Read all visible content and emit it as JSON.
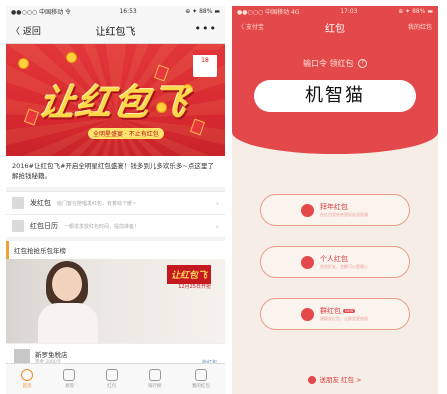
{
  "left": {
    "status": {
      "carrier": "●●○○○ 中国移动 令",
      "time": "16:53",
      "battery": "⊕ ✦ 88% ▬"
    },
    "nav": {
      "back": "〈 返回",
      "title": "让红包飞",
      "more": "•••"
    },
    "banner": {
      "headline": "让红包飞",
      "slogan": "全明星盛宴 · 不止有红包",
      "calendar_month": "3月",
      "calendar_day": "18"
    },
    "intro": "2016#让红包飞#开启全明星红包盛宴！钱多到儿多欢乐多~点这里了解抢钱秘籍。",
    "menu": [
      {
        "name": "发红包",
        "desc": "给门客在陪唱发红包，有着综个暖~"
      },
      {
        "name": "红包日历",
        "desc": "一眼进发放红包时间，提前准备！"
      }
    ],
    "section_title": "红包抢抢乐包年榜",
    "promo": {
      "logo": "让红包飞",
      "sub": "12月25日开抢"
    },
    "shop": {
      "name": "新罗免税店",
      "sub": "现金 2000元",
      "tag": "抢红包"
    },
    "tabs": [
      {
        "label": "首页",
        "active": true
      },
      {
        "label": "发现",
        "active": false
      },
      {
        "label": "红包",
        "active": false
      },
      {
        "label": "排行榜",
        "active": false
      },
      {
        "label": "我的红包",
        "active": false
      }
    ]
  },
  "right": {
    "status": {
      "carrier": "●●○○○ 中国移动 4G",
      "time": "17:03",
      "battery": "⊕ ✦ 88% ▬"
    },
    "nav": {
      "back": "〈 支付宝",
      "title": "红包",
      "mine": "我的红包"
    },
    "prompt": "输口令 领红包",
    "prompt_help": "?",
    "code": "机智猫",
    "buttons": [
      {
        "name": "拜年红包",
        "desc": "在红包里给亲朋好友送祝福"
      },
      {
        "name": "个人红包",
        "desc": "发给好友，金额可以更随心"
      },
      {
        "name": "群红包",
        "badge": "NEW",
        "desc": "建群发红包，让群里更热闹"
      }
    ],
    "footer": "送朋友 红包 >"
  },
  "colors": {
    "red": "#e3484b",
    "orange": "#f08a2a",
    "gold": "#ffd84a"
  }
}
